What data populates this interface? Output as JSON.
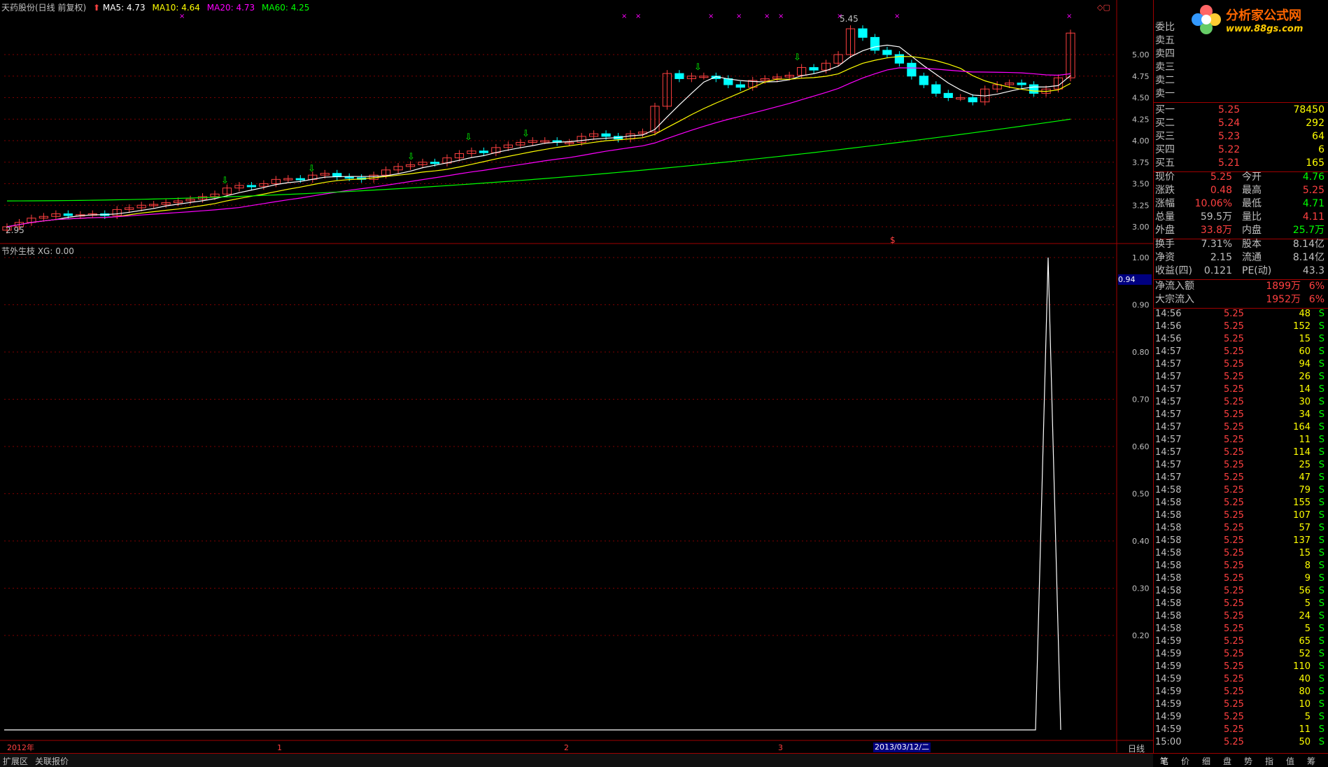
{
  "header": {
    "title": "天药股份(日线 前复权)",
    "ma5": "MA5: 4.73",
    "ma10": "MA10: 4.64",
    "ma20": "MA20: 4.73",
    "ma60": "MA60: 4.25",
    "high_mark": "5.45",
    "low_mark": "2.95"
  },
  "indicator": {
    "title": "节外生枝 XG: 0.00",
    "value_box": "0.94"
  },
  "axis": {
    "price_ticks": [
      "5.00",
      "4.75",
      "4.50",
      "4.25",
      "4.00",
      "3.75",
      "3.50",
      "3.25",
      "3.00"
    ],
    "indicator_ticks": [
      "1.00",
      "0.90",
      "0.80",
      "0.70",
      "0.60",
      "0.50",
      "0.40",
      "0.30",
      "0.20"
    ],
    "time_labels": [
      "2012年",
      "1",
      "2",
      "3"
    ],
    "cursor_date": "2013/03/12/二",
    "period": "日线",
    "dollar_mark": "$"
  },
  "bottom_bar": {
    "tab1": "扩展区",
    "tab2": "关联报价"
  },
  "logo": {
    "name": "分析家公式网",
    "url": "www.88gs.com"
  },
  "order_book": {
    "ratio_label": "委比",
    "sells": [
      "卖五",
      "卖四",
      "卖三",
      "卖二",
      "卖一"
    ],
    "buys": [
      {
        "label": "买一",
        "price": "5.25",
        "vol": "78450"
      },
      {
        "label": "买二",
        "price": "5.24",
        "vol": "292"
      },
      {
        "label": "买三",
        "price": "5.23",
        "vol": "64"
      },
      {
        "label": "买四",
        "price": "5.22",
        "vol": "6"
      },
      {
        "label": "买五",
        "price": "5.21",
        "vol": "165"
      }
    ]
  },
  "quote": [
    {
      "l1": "现价",
      "v1": "5.25",
      "c1": "#ff4040",
      "l2": "今开",
      "v2": "4.76",
      "c2": "#00ff00"
    },
    {
      "l1": "涨跌",
      "v1": "0.48",
      "c1": "#ff4040",
      "l2": "最高",
      "v2": "5.25",
      "c2": "#ff4040"
    },
    {
      "l1": "涨幅",
      "v1": "10.06%",
      "c1": "#ff4040",
      "l2": "最低",
      "v2": "4.71",
      "c2": "#00ff00"
    },
    {
      "l1": "总量",
      "v1": "59.5万",
      "c1": "#c0c0c0",
      "l2": "量比",
      "v2": "4.11",
      "c2": "#ff4040"
    },
    {
      "l1": "外盘",
      "v1": "33.8万",
      "c1": "#ff4040",
      "l2": "内盘",
      "v2": "25.7万",
      "c2": "#00ff00"
    }
  ],
  "fund": [
    {
      "l1": "换手",
      "v1": "7.31%",
      "l2": "股本",
      "v2": "8.14亿"
    },
    {
      "l1": "净资",
      "v1": "2.15",
      "l2": "流通",
      "v2": "8.14亿"
    },
    {
      "l1": "收益(四)",
      "v1": "0.121",
      "l2": "PE(动)",
      "v2": "43.3"
    }
  ],
  "flow": [
    {
      "label": "净流入额",
      "value": "1899万",
      "pct": "6%"
    },
    {
      "label": "大宗流入",
      "value": "1952万",
      "pct": "6%"
    }
  ],
  "ticks": [
    {
      "t": "14:56",
      "p": "5.25",
      "v": "48",
      "s": "S"
    },
    {
      "t": "14:56",
      "p": "5.25",
      "v": "152",
      "s": "S"
    },
    {
      "t": "14:56",
      "p": "5.25",
      "v": "15",
      "s": "S"
    },
    {
      "t": "14:57",
      "p": "5.25",
      "v": "60",
      "s": "S"
    },
    {
      "t": "14:57",
      "p": "5.25",
      "v": "94",
      "s": "S"
    },
    {
      "t": "14:57",
      "p": "5.25",
      "v": "26",
      "s": "S"
    },
    {
      "t": "14:57",
      "p": "5.25",
      "v": "14",
      "s": "S"
    },
    {
      "t": "14:57",
      "p": "5.25",
      "v": "30",
      "s": "S"
    },
    {
      "t": "14:57",
      "p": "5.25",
      "v": "34",
      "s": "S"
    },
    {
      "t": "14:57",
      "p": "5.25",
      "v": "164",
      "s": "S"
    },
    {
      "t": "14:57",
      "p": "5.25",
      "v": "11",
      "s": "S"
    },
    {
      "t": "14:57",
      "p": "5.25",
      "v": "114",
      "s": "S"
    },
    {
      "t": "14:57",
      "p": "5.25",
      "v": "25",
      "s": "S"
    },
    {
      "t": "14:57",
      "p": "5.25",
      "v": "47",
      "s": "S"
    },
    {
      "t": "14:58",
      "p": "5.25",
      "v": "79",
      "s": "S"
    },
    {
      "t": "14:58",
      "p": "5.25",
      "v": "155",
      "s": "S"
    },
    {
      "t": "14:58",
      "p": "5.25",
      "v": "107",
      "s": "S"
    },
    {
      "t": "14:58",
      "p": "5.25",
      "v": "57",
      "s": "S"
    },
    {
      "t": "14:58",
      "p": "5.25",
      "v": "137",
      "s": "S"
    },
    {
      "t": "14:58",
      "p": "5.25",
      "v": "15",
      "s": "S"
    },
    {
      "t": "14:58",
      "p": "5.25",
      "v": "8",
      "s": "S"
    },
    {
      "t": "14:58",
      "p": "5.25",
      "v": "9",
      "s": "S"
    },
    {
      "t": "14:58",
      "p": "5.25",
      "v": "56",
      "s": "S"
    },
    {
      "t": "14:58",
      "p": "5.25",
      "v": "5",
      "s": "S"
    },
    {
      "t": "14:58",
      "p": "5.25",
      "v": "24",
      "s": "S"
    },
    {
      "t": "14:58",
      "p": "5.25",
      "v": "5",
      "s": "S"
    },
    {
      "t": "14:59",
      "p": "5.25",
      "v": "65",
      "s": "S"
    },
    {
      "t": "14:59",
      "p": "5.25",
      "v": "52",
      "s": "S"
    },
    {
      "t": "14:59",
      "p": "5.25",
      "v": "110",
      "s": "S"
    },
    {
      "t": "14:59",
      "p": "5.25",
      "v": "40",
      "s": "S"
    },
    {
      "t": "14:59",
      "p": "5.25",
      "v": "80",
      "s": "S"
    },
    {
      "t": "14:59",
      "p": "5.25",
      "v": "10",
      "s": "S"
    },
    {
      "t": "14:59",
      "p": "5.25",
      "v": "5",
      "s": "S"
    },
    {
      "t": "14:59",
      "p": "5.25",
      "v": "11",
      "s": "S"
    },
    {
      "t": "15:00",
      "p": "5.25",
      "v": "50",
      "s": "S"
    }
  ],
  "side_tabs": [
    "笔",
    "价",
    "细",
    "盘",
    "势",
    "指",
    "值",
    "筹"
  ],
  "colors": {
    "up": "#ff4040",
    "down": "#00ffff",
    "ma5": "#ffffff",
    "ma10": "#ffff00",
    "ma20": "#ff00ff",
    "ma60": "#00ff00",
    "grid": "#800000"
  },
  "chart_data": {
    "type": "candlestick",
    "series_close": [
      3.0,
      3.05,
      3.1,
      3.12,
      3.15,
      3.13,
      3.14,
      3.15,
      3.13,
      3.2,
      3.22,
      3.25,
      3.26,
      3.28,
      3.3,
      3.32,
      3.35,
      3.38,
      3.45,
      3.48,
      3.47,
      3.5,
      3.55,
      3.56,
      3.55,
      3.6,
      3.62,
      3.58,
      3.57,
      3.55,
      3.6,
      3.66,
      3.7,
      3.72,
      3.75,
      3.74,
      3.8,
      3.85,
      3.88,
      3.86,
      3.92,
      3.95,
      3.98,
      4.0,
      4.0,
      3.98,
      3.98,
      4.05,
      4.08,
      4.05,
      4.02,
      4.08,
      4.1,
      4.4,
      4.78,
      4.72,
      4.75,
      4.75,
      4.72,
      4.65,
      4.62,
      4.7,
      4.72,
      4.74,
      4.76,
      4.85,
      4.82,
      4.9,
      5.0,
      5.3,
      5.2,
      5.05,
      5.0,
      4.9,
      4.75,
      4.65,
      4.55,
      4.5,
      4.5,
      4.45,
      4.6,
      4.65,
      4.67,
      4.65,
      4.55,
      4.6,
      4.73,
      5.25
    ],
    "indicator_xg": [
      0,
      0,
      0,
      0,
      0,
      0,
      0,
      0,
      0,
      0,
      0,
      0,
      0,
      0,
      0,
      0,
      0,
      0,
      0,
      0,
      0,
      0,
      0,
      0,
      0,
      0,
      0,
      0,
      0,
      0,
      0,
      0,
      0,
      0,
      0,
      0,
      0,
      0,
      0,
      0,
      0,
      0,
      0,
      0,
      0,
      0,
      0,
      0,
      0,
      0,
      0,
      0,
      0,
      0,
      0,
      0,
      0,
      0,
      0,
      0,
      0,
      0,
      0,
      0,
      0,
      0,
      0,
      0,
      0,
      0,
      0,
      0,
      0,
      0,
      0,
      0,
      0,
      0,
      0,
      0,
      0,
      0,
      0,
      0,
      0,
      1,
      0
    ]
  }
}
